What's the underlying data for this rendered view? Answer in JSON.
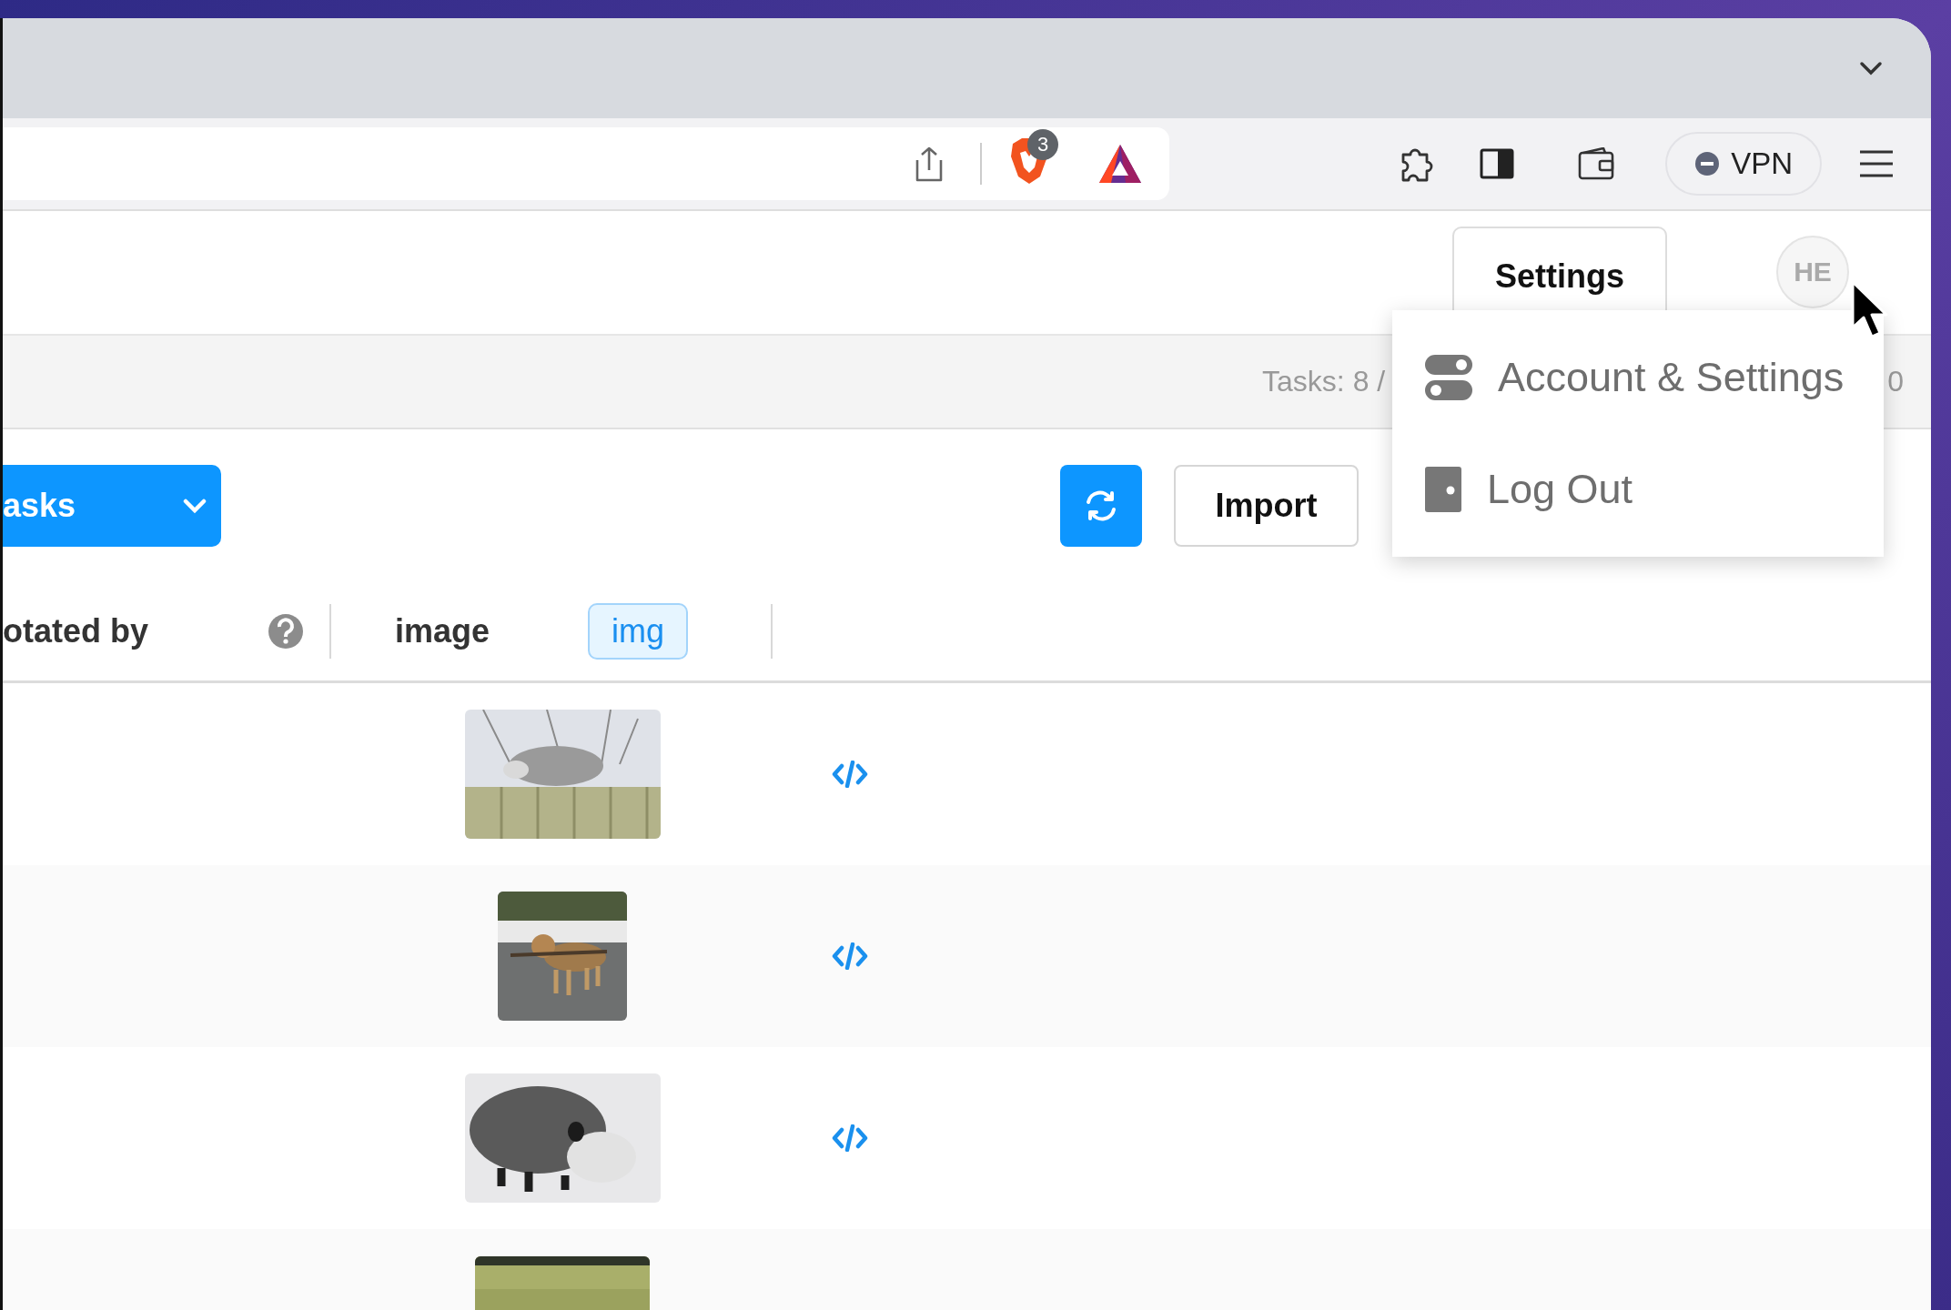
{
  "browser": {
    "shields_count": "3",
    "vpn_label": "VPN"
  },
  "header": {
    "settings_button": "Settings",
    "avatar": "HE"
  },
  "menu": {
    "items": [
      {
        "label": "Account & Settings",
        "kind": "toggles"
      },
      {
        "label": "Log Out",
        "kind": "door"
      }
    ]
  },
  "stats": {
    "tasks": "Tasks: 8 /",
    "tail": "0"
  },
  "actions": {
    "tasks_button": "asks",
    "import_button": "Import"
  },
  "table": {
    "columns": [
      {
        "label": "otated by",
        "kind": "help"
      },
      {
        "label": "image",
        "tag": "img",
        "kind": "tagged"
      }
    ]
  }
}
